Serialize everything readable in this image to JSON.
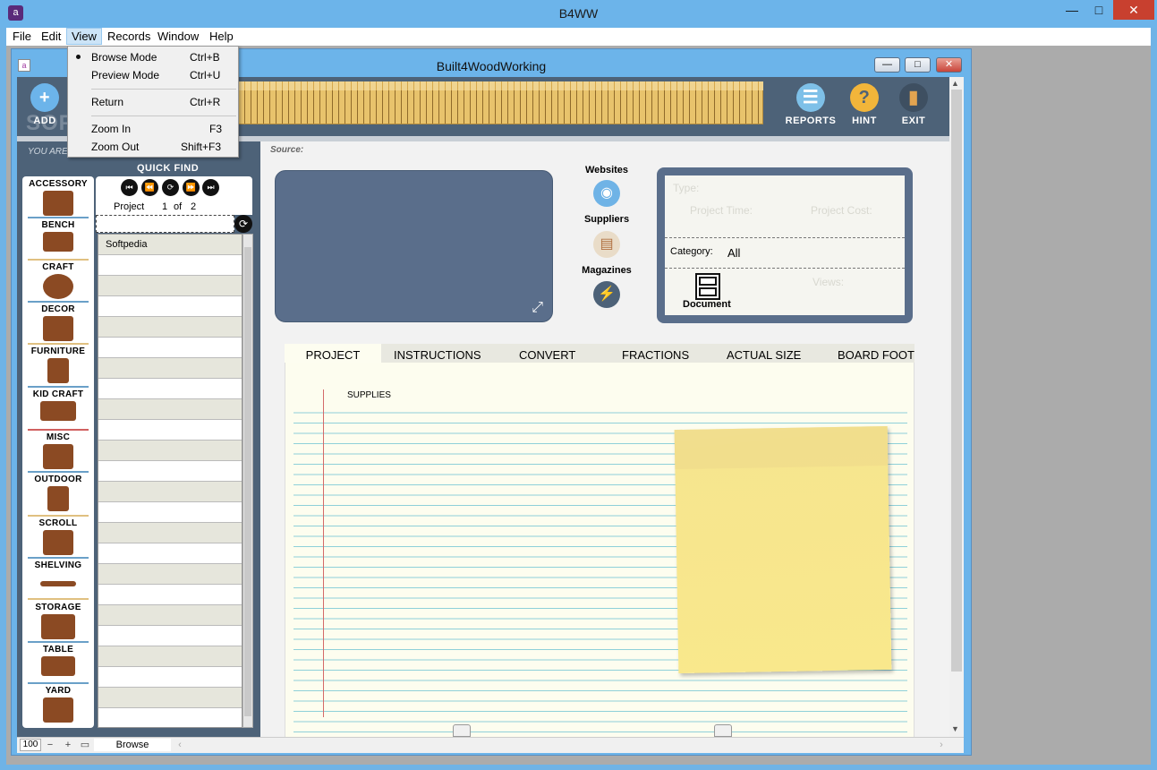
{
  "app": {
    "title": "B4WW",
    "inner_title": "Built4WoodWorking",
    "icon_glyph": "a",
    "accent": "#6cb4ea"
  },
  "menu": {
    "items": [
      "File",
      "Edit",
      "View",
      "Records",
      "Window",
      "Help"
    ],
    "active": "View"
  },
  "view_menu": {
    "items": [
      {
        "label": "Browse Mode",
        "shortcut": "Ctrl+B",
        "checked": true
      },
      {
        "label": "Preview Mode",
        "shortcut": "Ctrl+U"
      },
      {
        "label": "Return",
        "shortcut": "Ctrl+R"
      },
      {
        "label": "Zoom In",
        "shortcut": "F3"
      },
      {
        "label": "Zoom Out",
        "shortcut": "Shift+F3"
      }
    ]
  },
  "header": {
    "add_label": "ADD",
    "reports_label": "REPORTS",
    "hint_label": "HINT",
    "exit_label": "EXIT",
    "watermark": "SOFTPEDIA"
  },
  "left": {
    "you_are": "YOU ARE",
    "quick_find": "QUICK FIND",
    "nav_project": "Project",
    "nav_current": "1",
    "nav_of": "of",
    "nav_total": "2",
    "categories": [
      {
        "label": "ACCESSORY",
        "line_color": "#6aa0c8"
      },
      {
        "label": "BENCH",
        "line_color": "#e0c080"
      },
      {
        "label": "CRAFT",
        "line_color": "#6aa0c8"
      },
      {
        "label": "DECOR",
        "line_color": "#e0c080"
      },
      {
        "label": "FURNITURE",
        "line_color": "#6aa0c8"
      },
      {
        "label": "KID CRAFT",
        "line_color": "#d06060"
      },
      {
        "label": "MISC",
        "line_color": "#6aa0c8"
      },
      {
        "label": "OUTDOOR",
        "line_color": "#e0c080"
      },
      {
        "label": "SCROLL",
        "line_color": "#6aa0c8"
      },
      {
        "label": "SHELVING",
        "line_color": "#e0c080"
      },
      {
        "label": "STORAGE",
        "line_color": "#6aa0c8"
      },
      {
        "label": "TABLE",
        "line_color": "#6aa0c8"
      },
      {
        "label": "YARD",
        "line_color": "#6aa0c8"
      }
    ],
    "list_rows": [
      "Softpedia"
    ]
  },
  "main": {
    "source_label": "Source:",
    "websites_label": "Websites",
    "suppliers_label": "Suppliers",
    "magazines_label": "Magazines",
    "type_label": "Type:",
    "project_time_label": "Project Time:",
    "project_cost_label": "Project Cost:",
    "category_label": "Category:",
    "category_value": "All",
    "document_label": "Document",
    "views_label": "Views:",
    "tabs": [
      "PROJECT",
      "INSTRUCTIONS",
      "CONVERT",
      "FRACTIONS",
      "ACTUAL SIZE",
      "BOARD FOOT"
    ],
    "active_tab": "PROJECT",
    "supplies_label": "SUPPLIES"
  },
  "status": {
    "zoom": "100",
    "mode": "Browse"
  }
}
